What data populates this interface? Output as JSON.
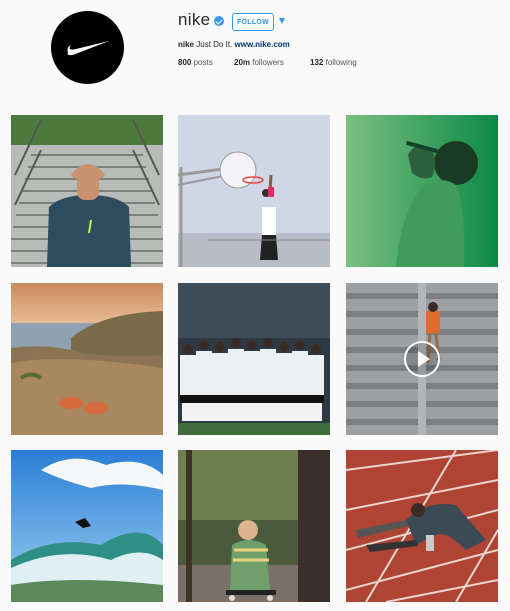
{
  "profile": {
    "username": "nike",
    "follow_label": "FOLLOW",
    "bio_name": "nike",
    "bio_text": "Just Do It.",
    "bio_link": "www.nike.com",
    "stats": {
      "posts_count": "800",
      "posts_label": "posts",
      "followers_count": "20m",
      "followers_label": "followers",
      "following_count": "132",
      "following_label": "following"
    }
  },
  "colors": {
    "accent": "#3897f0"
  },
  "icons": [
    "swoosh-logo",
    "verified-badge-icon",
    "dropdown-arrow-icon",
    "play-icon"
  ],
  "grid": {
    "posts": [
      {
        "name": "stadium-stairs-photo",
        "type": "photo"
      },
      {
        "name": "basketball-hoop-photo",
        "type": "photo"
      },
      {
        "name": "tennis-athlete-green-photo",
        "type": "photo"
      },
      {
        "name": "coastal-cliff-shoes-photo",
        "type": "photo"
      },
      {
        "name": "team-huddle-photo",
        "type": "photo"
      },
      {
        "name": "stadium-runner-video",
        "type": "video"
      },
      {
        "name": "surfer-wave-photo",
        "type": "photo"
      },
      {
        "name": "child-skateboard-photo",
        "type": "photo"
      },
      {
        "name": "track-athlete-prosthetic-photo",
        "type": "photo"
      }
    ]
  }
}
